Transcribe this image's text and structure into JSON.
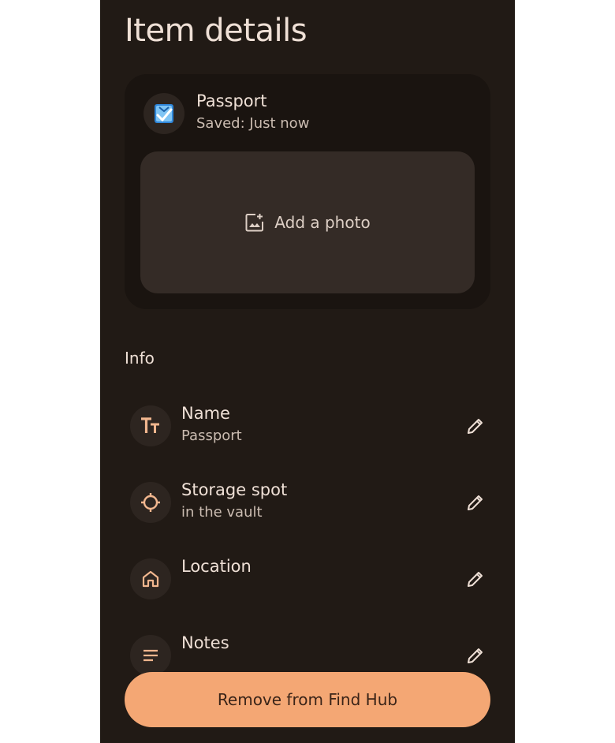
{
  "page": {
    "title": "Item details"
  },
  "item": {
    "name": "Passport",
    "saved_status": "Saved: Just now",
    "icon": "passport-icon",
    "add_photo_label": "Add a photo"
  },
  "info": {
    "heading": "Info",
    "rows": [
      {
        "title": "Name",
        "value": "Passport",
        "icon": "text-format-icon"
      },
      {
        "title": "Storage spot",
        "value": "in the vault",
        "icon": "target-icon"
      },
      {
        "title": "Location",
        "value": "",
        "icon": "home-icon"
      },
      {
        "title": "Notes",
        "value": "",
        "icon": "notes-icon"
      }
    ]
  },
  "actions": {
    "remove_label": "Remove from Find Hub"
  },
  "colors": {
    "background": "#211a15",
    "accent": "#f4a774",
    "icon_tint": "#f1b68e"
  }
}
